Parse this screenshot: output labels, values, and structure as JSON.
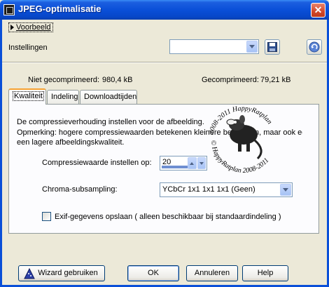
{
  "window": {
    "title": "JPEG-optimalisatie",
    "close_glyph": "✕"
  },
  "preview": {
    "label": "Voorbeeld"
  },
  "settings": {
    "label": "Instellingen",
    "preset_value": ""
  },
  "sizes": {
    "uncompressed_label": "Niet gecomprimeerd:",
    "uncompressed_value": "980,4 kB",
    "compressed_label": "Gecomprimeerd:",
    "compressed_value": "79,21 kB"
  },
  "tabs": [
    {
      "label": "Kwaliteit",
      "active": true
    },
    {
      "label": "Indeling",
      "active": false
    },
    {
      "label": "Downloadtijden",
      "active": false
    }
  ],
  "quality": {
    "description": "De compressieverhouding instellen voor de afbeelding.",
    "note_line1": "Opmerking:  hogere compressiewaarden betekenen kleinere bestanden, maar ook een",
    "note_line2": "een lagere afbeeldingskwaliteit.",
    "compression_label": "Compressiewaarde instellen op:",
    "compression_value": "20",
    "compression_fraction": 0.2,
    "chroma_label": "Chroma-subsampling:",
    "chroma_value": "YCbCr  1x1  1x1  1x1  (Geen)",
    "exif_label": "Exif-gegevens opslaan ( alleen beschikbaar bij standaardindeling )",
    "exif_checked": false
  },
  "watermark": {
    "text_top": "2008-2011  HappyRatplan",
    "text_bottom": "© HappyRatplan  2008-2011"
  },
  "buttons": {
    "wizard": "Wizard gebruiken",
    "ok": "OK",
    "cancel": "Annuleren",
    "help": "Help"
  },
  "colors": {
    "titlebar": "#0a4fd8",
    "face": "#ece9d8",
    "panel": "#fcfcfe",
    "tab_highlight": "#f6a233"
  }
}
